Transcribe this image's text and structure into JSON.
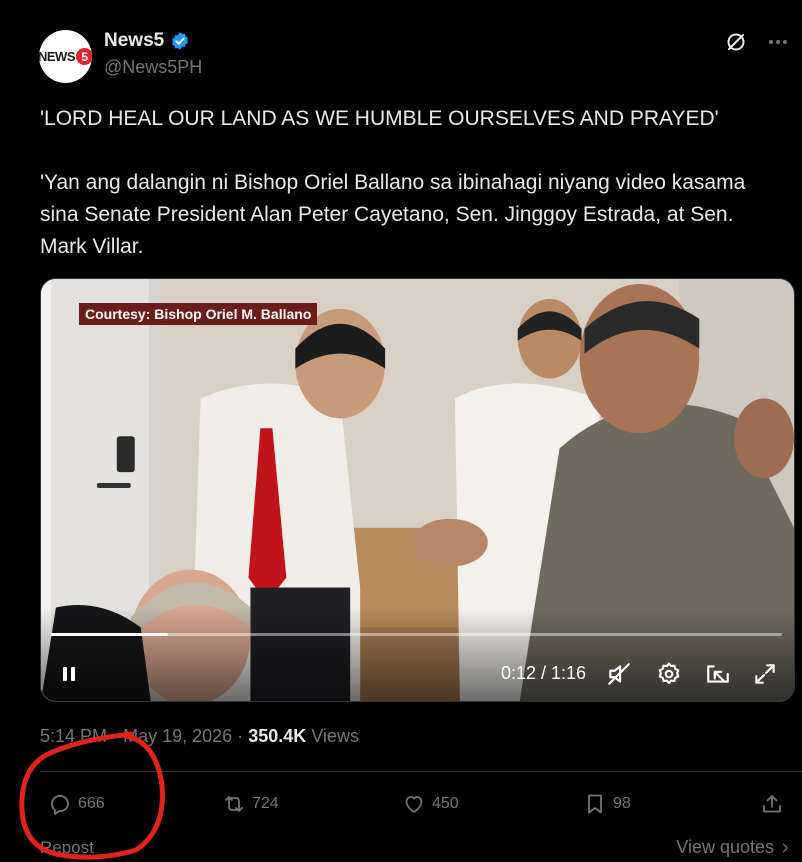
{
  "author": {
    "avatar_text": "NEWS",
    "avatar_number": "5",
    "display_name": "News5",
    "handle": "@News5PH",
    "verified_color": "#1d9bf0"
  },
  "tweet": {
    "text": "'LORD HEAL OUR LAND AS WE HUMBLE OURSELVES AND PRAYED'\n\n'Yan ang dalangin ni Bishop Oriel Ballano sa ibinahagi niyang video kasama sina Senate President Alan Peter Cayetano, Sen. Jinggoy Estrada, at Sen. Mark Villar."
  },
  "video": {
    "caption": "Courtesy: Bishop Oriel M. Ballano",
    "time_display": "0:12 / 1:16",
    "progress_fraction": 0.16
  },
  "meta": {
    "time": "5:14 PM",
    "separator1": "·",
    "date": "May 19, 2026",
    "separator2": "·",
    "views_count": "350.4K",
    "views_label": "Views"
  },
  "actions": {
    "replies": "666",
    "reposts": "724",
    "likes": "450",
    "bookmarks": "98"
  },
  "footer": {
    "repost_label": "Repost",
    "view_quotes": "View quotes"
  },
  "colors": {
    "background": "#000000",
    "text": "#e7e9ea",
    "muted": "#71767b",
    "annotation": "#e0241b"
  },
  "icons": [
    "grok-icon",
    "more-icon",
    "pause-icon",
    "mute-icon",
    "settings-icon",
    "pip-icon",
    "expand-icon",
    "reply-icon",
    "repost-icon",
    "like-icon",
    "bookmark-icon",
    "share-icon",
    "chevron-right-icon"
  ]
}
